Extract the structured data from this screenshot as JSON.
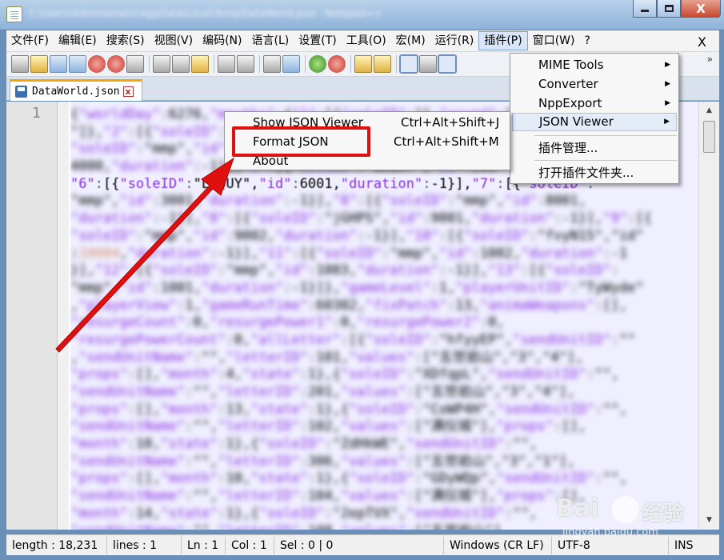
{
  "window": {
    "title": "C:\\Users\\Administrator\\AppData\\Local\\Temp\\DataWorld.json - Notepad++",
    "minimize": "–",
    "maximize": "□",
    "close": "X"
  },
  "menu": {
    "items": [
      "文件(F)",
      "编辑(E)",
      "搜索(S)",
      "视图(V)",
      "编码(N)",
      "语言(L)",
      "设置(T)",
      "工具(O)",
      "宏(M)",
      "运行(R)",
      "插件(P)",
      "窗口(W)",
      "?"
    ],
    "close": "X"
  },
  "toolbar": {
    "more": "»"
  },
  "tab": {
    "label": "DataWorld.json",
    "close": "x"
  },
  "editor": {
    "line_number": "1",
    "lines": [
      "{\"worldDay\":6276,\"mouths\":{\"1\":[{\"soleID\":\"\",\"sound\":\"...\"",
      "\"]},\"2\":[{\"soleID\":\"mmp\",\"id\":1001,\"duration\":-1}],\"3\":",
      "\"soleID\":\"mmp\",\"id\":4001,\"duration\":-1}],\"4\":[{\"soleID\":",
      "4000,\"duration\":-1}],\"5\":[{\"soleID\":\"wxuJf\",\"id\":500",
      "\"6\":[{\"soleID\":\"LRQUY\",\"id\":6001,\"duration\":-1}],\"7\":[{\"soleID\":",
      "\"mmp\",\"id\":3001,\"duration\":-1}],\"8\":[{\"soleID\":\"mmp\",\"id\":8001,",
      "\"duration\":-1}],\"8\":[{\"soleID\":\"jGHPS\",\"id\":9001,\"duration\":-1}],\"9\":[{",
      "\"soleID\":\"mmp\",\"id\":9002,\"duration\":-1}],\"10\":[{\"soleID\":\"fvyN15\",\"id\"",
      ":10004,\"duration\":-1}],\"11\":[{\"soleID\":\"mmp\",\"id\":1002,\"duration\":-1",
      "}],\"12\":[{\"soleID\":\"mmp\",\"id\":1003,\"duration\":-1}],\"13\":[{\"soleID\":",
      "\"mmp\",\"id\":1001,\"duration\":-1}]},\"gameLevel\":1,\"playerUnitID\":\"TyWyde\"",
      ",\"playerView\":1,\"gameRunTime\":60302,\"fixPatch\":13,\"animaWeapons\":[],",
      "\"resurgeCount\":0,\"resurgePower1\":0,\"resurgePower2\":0,",
      "\"resurgePowerCount\":0,\"allLetter\":[{\"soleID\":\"hfyyEP\",\"sendUnitID\":\"\"",
      ",\"sendUnitName\":\"\",\"letterID\":101,\"values\":[\"五世岩山\",\"3\",\"4\"],",
      "\"props\":[],\"month\":4,\"state\":1},{\"soleID\":\"XDfqpL\",\"sendUnitID\":\"\",",
      "\"sendUnitName\":\"\",\"letterID\":201,\"values\":[\"五世岩山\",\"3\",\"4\"],",
      "\"props\":[],\"month\":13,\"state\":1},{\"soleID\":\"CoWP4H\",\"sendUnitID\":\"\",",
      "\"sendUnitName\":\"\",\"letterID\":102,\"values\":[\"满仪城\"],\"props\":[],",
      "\"month\":10,\"state\":1},{\"soleID\":\"ZdHkWE\",\"sendUnitID\":\"\",",
      "\"sendUnitName\":\"\",\"letterID\":306,\"values\":[\"五世岩山\",\"3\",\"1\"],",
      "\"props\":[],\"month\":10,\"state\":1},{\"soleID\":\"GDyWQp\",\"sendUnitID\":\"\",",
      "\"sendUnitName\":\"\",\"letterID\":104,\"values\":[\"满仪城\"],\"props\":[],",
      "\"month\":14,\"state\":1},{\"soleID\":\"2epTVX\",\"sendUnitID\":\"\",",
      "\"sendUnitName\":\"\",\"letterID\":108,\"values\":[\"五世岩山\"]"
    ]
  },
  "status": {
    "length": "length : 18,231",
    "lines": "lines : 1",
    "ln": "Ln : 1",
    "col": "Col : 1",
    "sel": "Sel : 0 | 0",
    "eol": "Windows (CR LF)",
    "encoding": "UTF-8",
    "mode": "INS"
  },
  "plugins_menu": {
    "items": [
      {
        "label": "MIME Tools",
        "submenu": true
      },
      {
        "label": "Converter",
        "submenu": true
      },
      {
        "label": "NppExport",
        "submenu": true
      },
      {
        "label": "JSON Viewer",
        "submenu": true
      },
      {
        "label": "插件管理...",
        "submenu": false
      },
      {
        "label": "打开插件文件夹...",
        "submenu": false
      }
    ],
    "arrow": "▶"
  },
  "json_viewer_menu": {
    "items": [
      {
        "label": "Show JSON Viewer",
        "shortcut": "Ctrl+Alt+Shift+J"
      },
      {
        "label": "Format JSON",
        "shortcut": "Ctrl+Alt+Shift+M"
      },
      {
        "label": "About",
        "shortcut": ""
      }
    ]
  },
  "annotation": {
    "box_color": "#e01010",
    "arrow_color": "#e01010"
  },
  "watermark": {
    "text": "Bai",
    "text2": "经验",
    "sub": "jingyan.baidu.com"
  }
}
